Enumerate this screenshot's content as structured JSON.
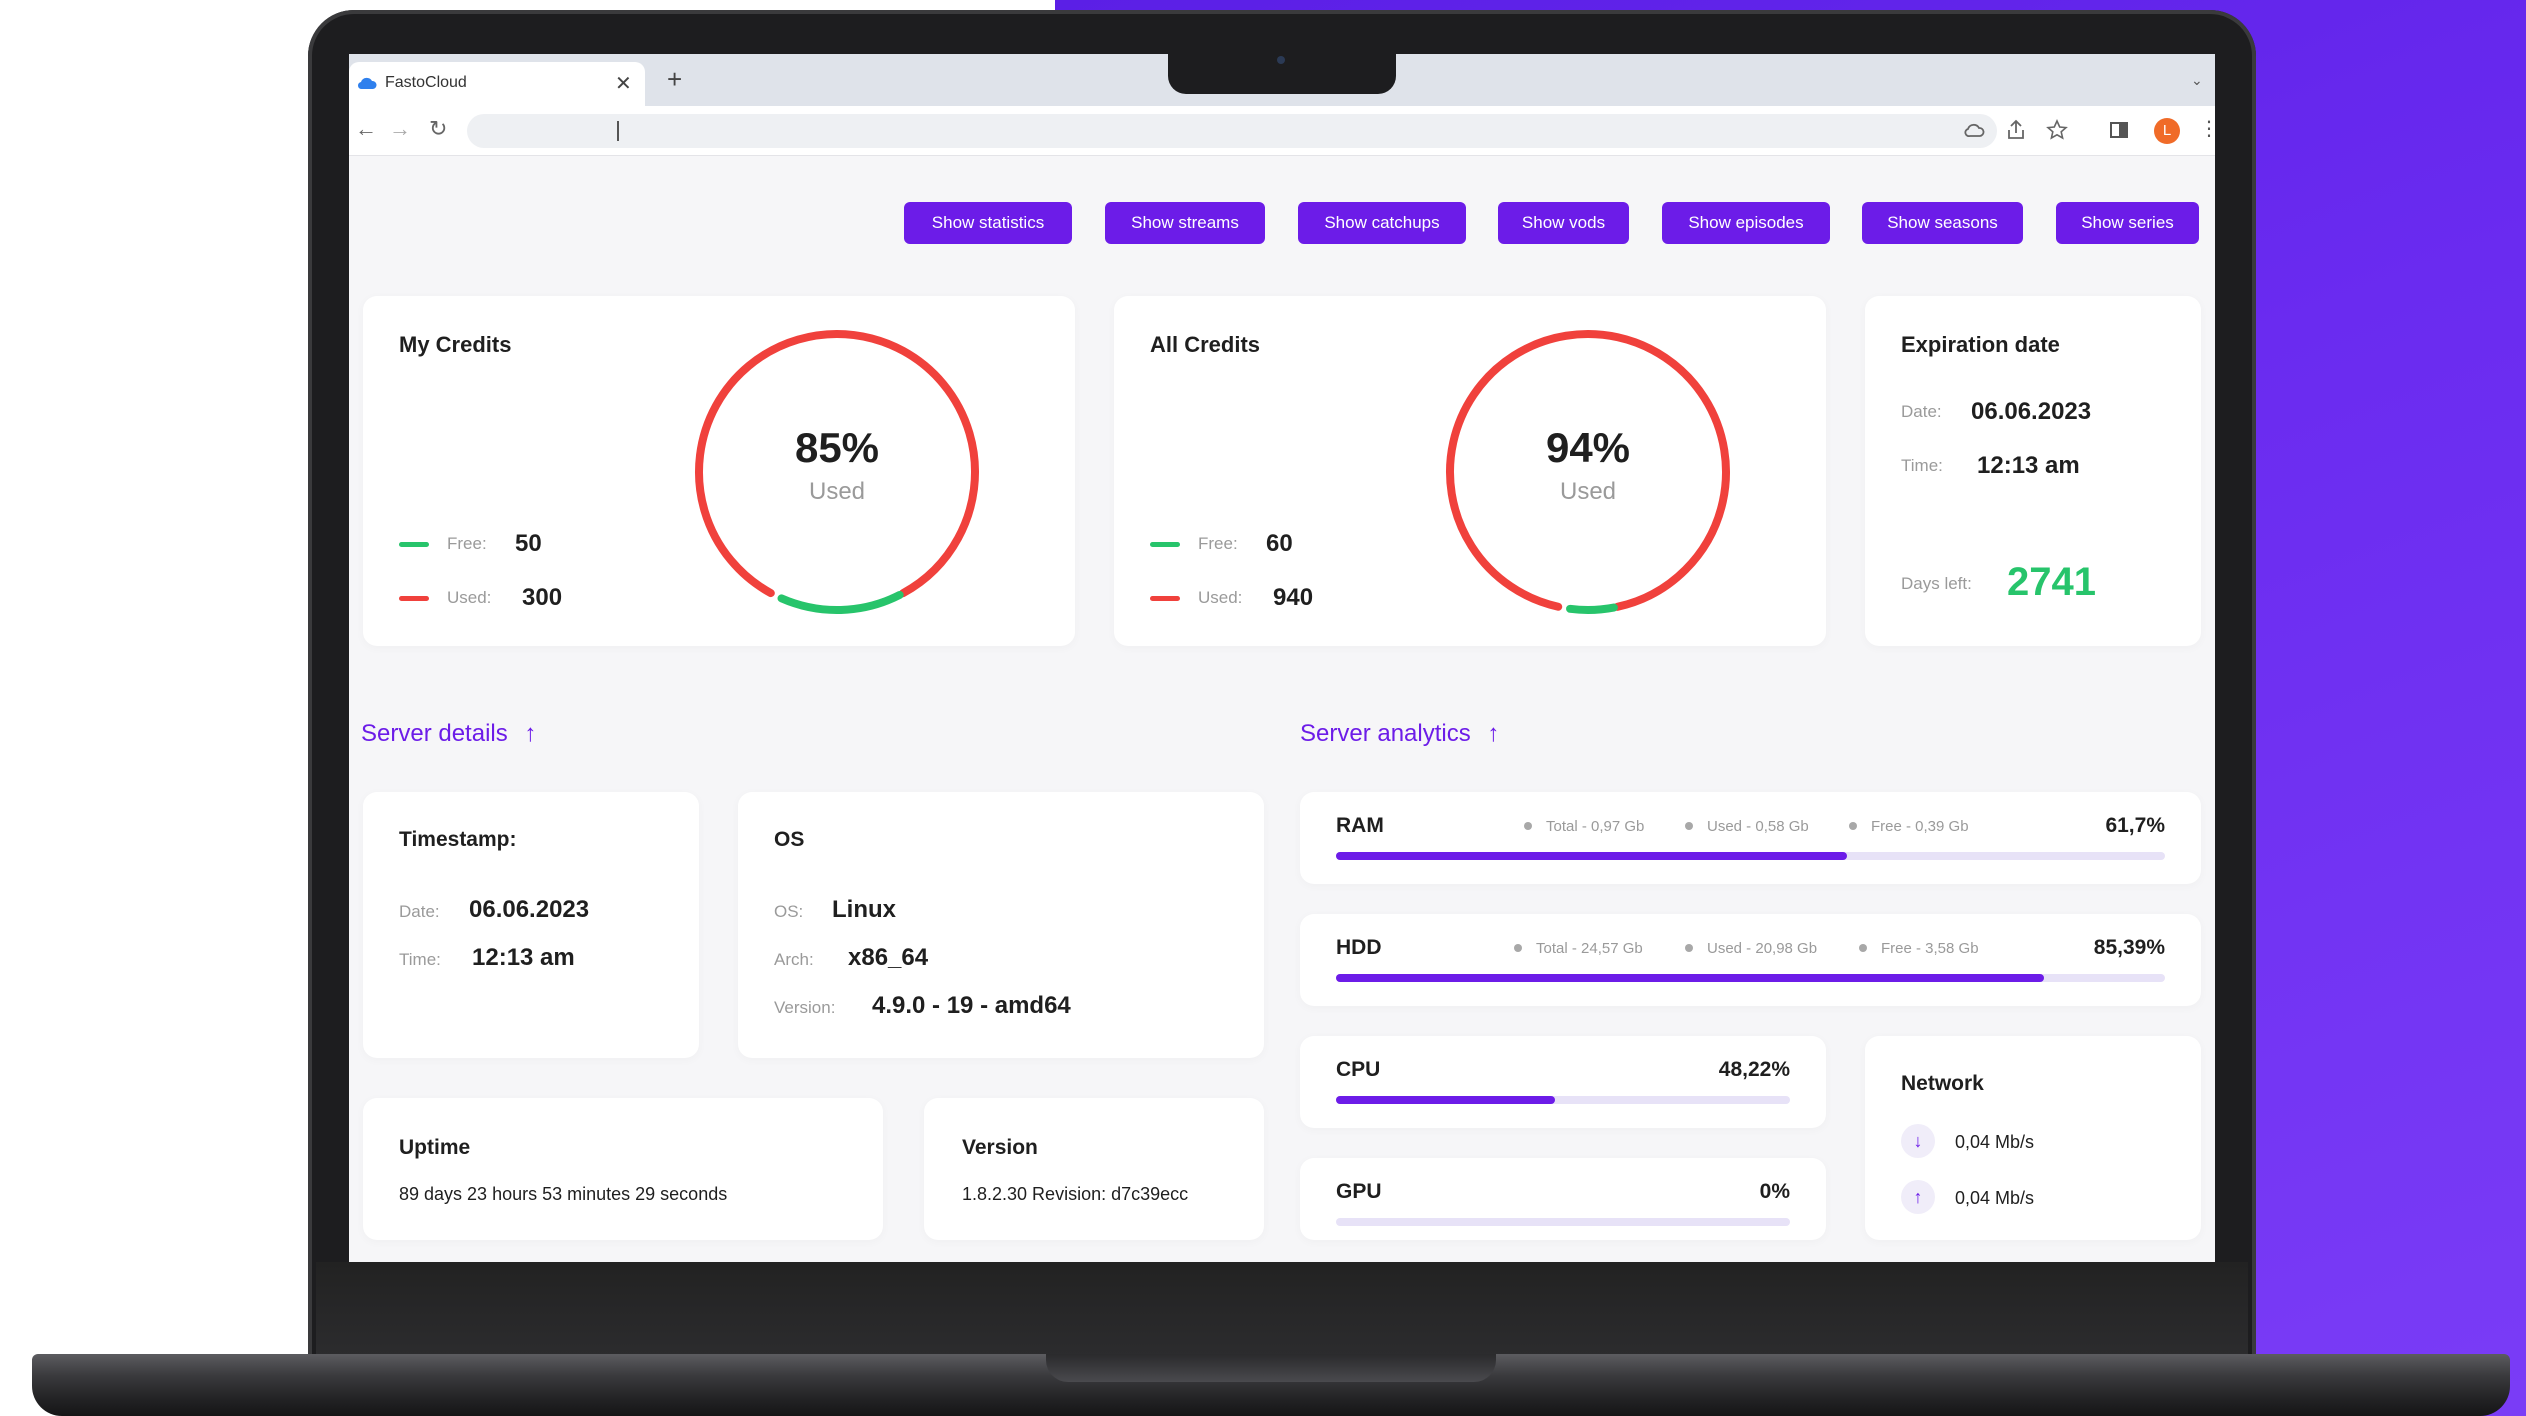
{
  "browser": {
    "tab_title": "FastoCloud",
    "tab_close": "✕",
    "new_tab": "+",
    "avatar_letter": "L",
    "address_value": ""
  },
  "actions": [
    {
      "label": "Show statistics"
    },
    {
      "label": "Show streams"
    },
    {
      "label": "Show catchups"
    },
    {
      "label": "Show vods"
    },
    {
      "label": "Show episodes"
    },
    {
      "label": "Show seasons"
    },
    {
      "label": "Show series"
    }
  ],
  "my_credits": {
    "title": "My Credits",
    "free_label": "Free:",
    "free_value": "50",
    "used_label": "Used:",
    "used_value": "300",
    "percent": "85%",
    "percent_label": "Used",
    "used_fraction": 0.85
  },
  "all_credits": {
    "title": "All Credits",
    "free_label": "Free:",
    "free_value": "60",
    "used_label": "Used:",
    "used_value": "940",
    "percent": "94%",
    "percent_label": "Used",
    "used_fraction": 0.94
  },
  "expiration": {
    "title": "Expiration date",
    "date_label": "Date:",
    "date_value": "06.06.2023",
    "time_label": "Time:",
    "time_value": "12:13 am",
    "days_label": "Days left:",
    "days_value": "2741"
  },
  "server_details": {
    "link_label": "Server details",
    "timestamp": {
      "title": "Timestamp:",
      "date_label": "Date:",
      "date_value": "06.06.2023",
      "time_label": "Time:",
      "time_value": "12:13 am"
    },
    "os": {
      "title": "OS",
      "os_label": "OS:",
      "os_value": "Linux",
      "arch_label": "Arch:",
      "arch_value": "x86_64",
      "version_label": "Version:",
      "version_value": "4.9.0 - 19 - amd64"
    },
    "uptime": {
      "title": "Uptime",
      "value": "89 days 23 hours 53 minutes 29 seconds"
    },
    "version": {
      "title": "Version",
      "value": "1.8.2.30 Revision: d7c39ecc"
    }
  },
  "server_analytics": {
    "link_label": "Server analytics",
    "ram": {
      "name": "RAM",
      "total": "Total - 0,97 Gb",
      "used": "Used - 0,58 Gb",
      "free": "Free - 0,39 Gb",
      "percent": "61,7%",
      "fraction": 0.617
    },
    "hdd": {
      "name": "HDD",
      "total": "Total - 24,57 Gb",
      "used": "Used - 20,98 Gb",
      "free": "Free - 3,58 Gb",
      "percent": "85,39%",
      "fraction": 0.8539
    },
    "cpu": {
      "name": "CPU",
      "percent": "48,22%",
      "fraction": 0.4822
    },
    "gpu": {
      "name": "GPU",
      "percent": "0%",
      "fraction": 0
    },
    "network": {
      "title": "Network",
      "down": "0,04 Mb/s",
      "up": "0,04 Mb/s"
    }
  },
  "colors": {
    "accent": "#6c1ce8",
    "used": "#f0413c",
    "free": "#27c46b",
    "background_purple": "#6a2bf0"
  },
  "icons": [
    "cloud-icon",
    "close-icon",
    "plus-icon",
    "back-arrow-icon",
    "forward-arrow-icon",
    "reload-icon",
    "cloud-sync-icon",
    "share-icon",
    "star-icon",
    "sidebar-icon",
    "kebab-menu-icon",
    "arrow-up-icon",
    "download-arrow-icon",
    "upload-arrow-icon"
  ]
}
